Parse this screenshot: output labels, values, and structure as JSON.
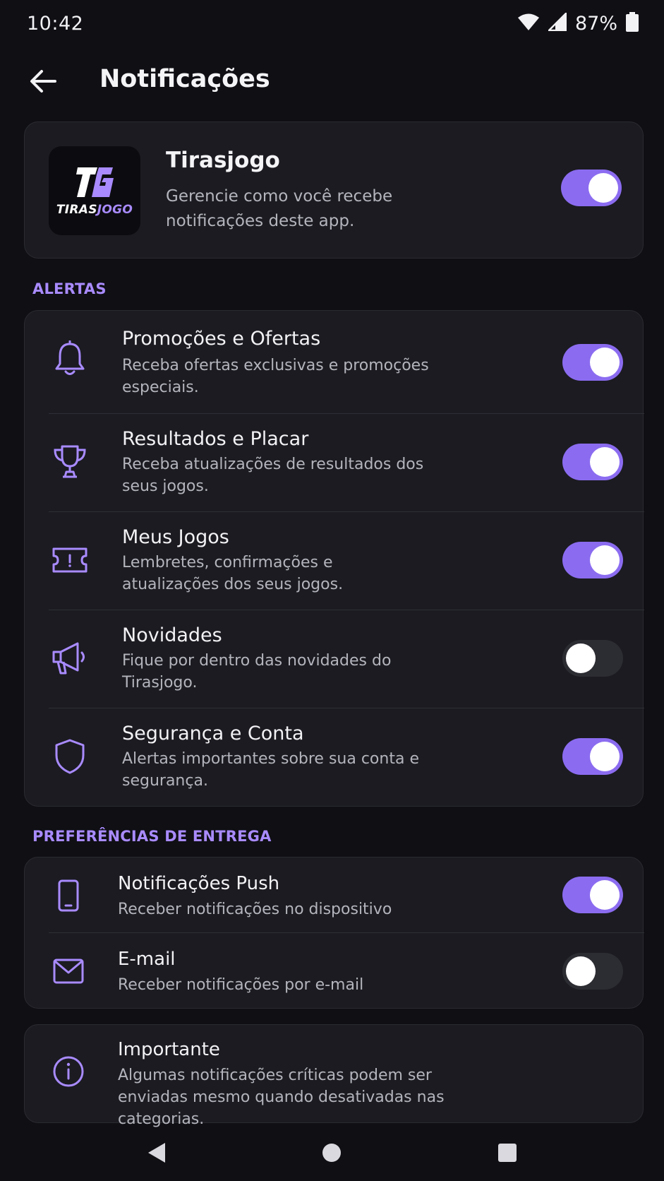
{
  "status_bar": {
    "time": "10:42",
    "battery": "87%"
  },
  "header": {
    "title": "Notificações"
  },
  "app": {
    "name": "Tirasjogo",
    "description": "Gerencie como você recebe notificações deste app.",
    "logo_text_1": "TIRAS",
    "logo_text_2": "JOGO",
    "enabled": true
  },
  "sections": {
    "alerts_label": "ALERTAS",
    "delivery_label": "PREFERÊNCIAS DE ENTREGA"
  },
  "alerts": [
    {
      "title": "Promoções e Ofertas",
      "desc": "Receba ofertas exclusivas e promoções especiais.",
      "icon": "bell-icon",
      "enabled": true
    },
    {
      "title": "Resultados e Placar",
      "desc": "Receba atualizações de resultados dos seus jogos.",
      "icon": "trophy-icon",
      "enabled": true
    },
    {
      "title": "Meus Jogos",
      "desc": "Lembretes, confirmações e atualizações dos seus jogos.",
      "icon": "ticket-icon",
      "enabled": true
    },
    {
      "title": "Novidades",
      "desc": "Fique por dentro das novidades do Tirasjogo.",
      "icon": "megaphone-icon",
      "enabled": false
    },
    {
      "title": "Segurança e Conta",
      "desc": "Alertas importantes sobre sua conta e segurança.",
      "icon": "shield-icon",
      "enabled": true
    }
  ],
  "delivery": [
    {
      "title": "Notificações Push",
      "desc": "Receber notificações no dispositivo",
      "icon": "phone-icon",
      "enabled": true
    },
    {
      "title": "E-mail",
      "desc": "Receber notificações por e-mail",
      "icon": "mail-icon",
      "enabled": false
    }
  ],
  "info": {
    "title": "Importante",
    "desc": "Algumas notificações críticas podem ser enviadas mesmo quando desativadas nas categorias.",
    "icon": "info-icon"
  },
  "colors": {
    "accent": "#8b6cf0",
    "accent_text": "#a98bff",
    "background": "#0f0f14",
    "card": "#1b1b21"
  }
}
